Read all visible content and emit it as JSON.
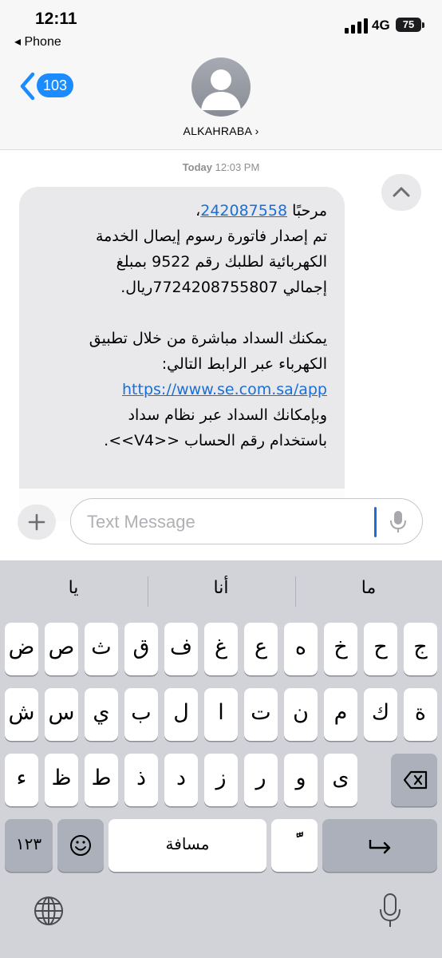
{
  "status_bar": {
    "time": "12:11",
    "back_app": "◂ Phone",
    "network": "4G",
    "battery": "75"
  },
  "nav": {
    "back_count": "103",
    "contact_name": "ALKAHRABA ›"
  },
  "thread": {
    "timestamp_day": "Today",
    "timestamp_time": " 12:03 PM",
    "message": {
      "greeting": "مرحبًا ",
      "account_link": "242087558",
      "greeting_end": "،",
      "line2": "تم إصدار فاتورة رسوم إيصال الخدمة",
      "line3": "الكهربائية لطلبك رقم 9522 بمبلغ",
      "line4": "إجمالي 7724208755807ريال.",
      "line5": "يمكنك السداد مباشرة من خلال تطبيق",
      "line6": "الكهرباء عبر الرابط التالي:",
      "url": "https://www.se.com.sa/app",
      "line8": "وبإمكانك السداد عبر نظام سداد",
      "line9": "باستخدام رقم الحساب <<V4>>."
    }
  },
  "compose": {
    "placeholder": "Text Message"
  },
  "keyboard": {
    "suggestions": [
      "يا",
      "أنا",
      "ما"
    ],
    "row1": [
      "ض",
      "ص",
      "ث",
      "ق",
      "ف",
      "غ",
      "ع",
      "ه",
      "خ",
      "ح",
      "ج"
    ],
    "row2": [
      "ش",
      "س",
      "ي",
      "ب",
      "ل",
      "ا",
      "ت",
      "ن",
      "م",
      "ك",
      "ة"
    ],
    "row3": [
      "ء",
      "ظ",
      "ط",
      "ذ",
      "د",
      "ز",
      "ر",
      "و",
      "ى"
    ],
    "numbers_key": "١٢٣",
    "space_key": "مسافة",
    "diacritic_key": "ًّ"
  }
}
